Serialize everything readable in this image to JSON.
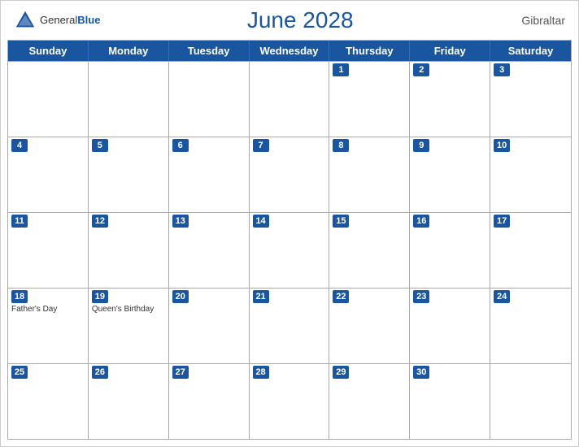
{
  "header": {
    "logo_general": "General",
    "logo_blue": "Blue",
    "title": "June 2028",
    "region": "Gibraltar"
  },
  "days": [
    "Sunday",
    "Monday",
    "Tuesday",
    "Wednesday",
    "Thursday",
    "Friday",
    "Saturday"
  ],
  "weeks": [
    [
      {
        "date": "",
        "events": []
      },
      {
        "date": "",
        "events": []
      },
      {
        "date": "",
        "events": []
      },
      {
        "date": "",
        "events": []
      },
      {
        "date": "1",
        "events": []
      },
      {
        "date": "2",
        "events": []
      },
      {
        "date": "3",
        "events": []
      }
    ],
    [
      {
        "date": "4",
        "events": []
      },
      {
        "date": "5",
        "events": []
      },
      {
        "date": "6",
        "events": []
      },
      {
        "date": "7",
        "events": []
      },
      {
        "date": "8",
        "events": []
      },
      {
        "date": "9",
        "events": []
      },
      {
        "date": "10",
        "events": []
      }
    ],
    [
      {
        "date": "11",
        "events": []
      },
      {
        "date": "12",
        "events": []
      },
      {
        "date": "13",
        "events": []
      },
      {
        "date": "14",
        "events": []
      },
      {
        "date": "15",
        "events": []
      },
      {
        "date": "16",
        "events": []
      },
      {
        "date": "17",
        "events": []
      }
    ],
    [
      {
        "date": "18",
        "events": [
          "Father's Day"
        ]
      },
      {
        "date": "19",
        "events": [
          "Queen's Birthday"
        ]
      },
      {
        "date": "20",
        "events": []
      },
      {
        "date": "21",
        "events": []
      },
      {
        "date": "22",
        "events": []
      },
      {
        "date": "23",
        "events": []
      },
      {
        "date": "24",
        "events": []
      }
    ],
    [
      {
        "date": "25",
        "events": []
      },
      {
        "date": "26",
        "events": []
      },
      {
        "date": "27",
        "events": []
      },
      {
        "date": "28",
        "events": []
      },
      {
        "date": "29",
        "events": []
      },
      {
        "date": "30",
        "events": []
      },
      {
        "date": "",
        "events": []
      }
    ]
  ]
}
